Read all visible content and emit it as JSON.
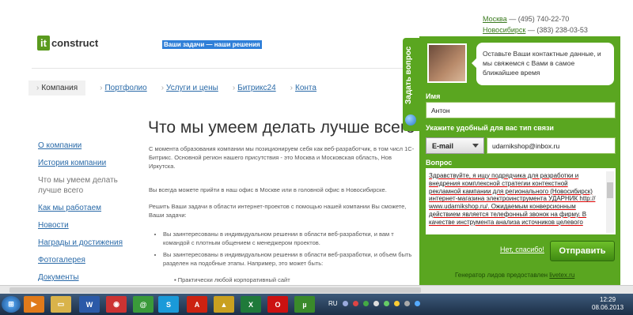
{
  "site": {
    "logo": {
      "it": "it",
      "rest": "construct"
    },
    "slogan": "Ваши задачи — наши решения",
    "contacts": [
      {
        "city": "Москва",
        "phone": " — (495) 740-22-70"
      },
      {
        "city": "Новосибирск",
        "phone": " — (383) 238-03-53"
      }
    ],
    "nav": [
      "Компания",
      "Портфолио",
      "Услуги и цены",
      "Битрикс24",
      "Конта"
    ],
    "sidebar": [
      "О компании",
      "История компании",
      "Что мы умеем делать лучше всего",
      "Как мы работаем",
      "Новости",
      "Награды и достижения",
      "Фотогалерея",
      "Документы"
    ],
    "heading": "Что мы умеем делать лучше всего",
    "paragraphs": [
      "С момента образования компании мы позиционируем себя как веб-разработчик, в том числ 1С-Битрикс. Основной регион нашего присутствия - это Москва и Московская область, Нов Иркутска.",
      "Вы всегда можете прийти в наш офис в Москве или в головной офис в Новосибирске.",
      "Решить Ваши задачи в области интернет-проектов с помощью нашей компании Вы сможете, Ваши задачи:"
    ],
    "bullets": [
      "Вы заинтересованы в индивидуальном решении в области веб-разработки, и вам т командой с плотным общением с менеджером проектов.",
      "Вы заинтересованы в индивидуальном решении в области веб-разработки, и объем быть разделен на подобные этапы. Например, это может быть:"
    ],
    "sub_bullet": "Практически любой корпоративный сайт"
  },
  "widget": {
    "tab_label": "Задать вопрос",
    "bubble": "Оставьте Ваши контактные данные, и мы свяжемся с Вами в самое ближайшее время",
    "name_label": "Имя",
    "name_value": "Антон",
    "contact_label": "Укажите удобный для вас тип связи",
    "contact_type": "E-mail",
    "contact_value": "udarnikshop@inbox.ru",
    "question_label": "Вопрос",
    "question_lines": [
      "Здравствуйте, я ищу подрядчика для разработки и",
      "внедрения комплексной стратегии контекстной",
      "рекламной кампании для регионального (Новосибирск)",
      "интернет-магазина электроинструмента УДАРНИК http://",
      "www.udarnikshop.ru/. Ожидаемым конверсионным",
      "действием является телефонный звонок на фирму. В",
      "качестве инструмента анализа источников целевого"
    ],
    "no_thanks": "Нет, спасибо!",
    "send": "Отправить",
    "credit_prefix": "Генератор лидов предоставлен ",
    "credit_link": "livetex.ru"
  },
  "taskbar": {
    "lang": "RU",
    "time": "12:29",
    "date": "08.06.2013",
    "apps": [
      "start-icon",
      "media-player-icon",
      "explorer-icon",
      "word-icon",
      "chrome-icon",
      "email-icon",
      "skype-icon",
      "pdf-icon",
      "bat-icon",
      "excel-icon",
      "opera-icon",
      "torrent-icon"
    ]
  },
  "colors": {
    "widget_green": "#5aa620",
    "link_blue": "#2a6aa8",
    "slogan_bg": "#2f7fd8"
  }
}
